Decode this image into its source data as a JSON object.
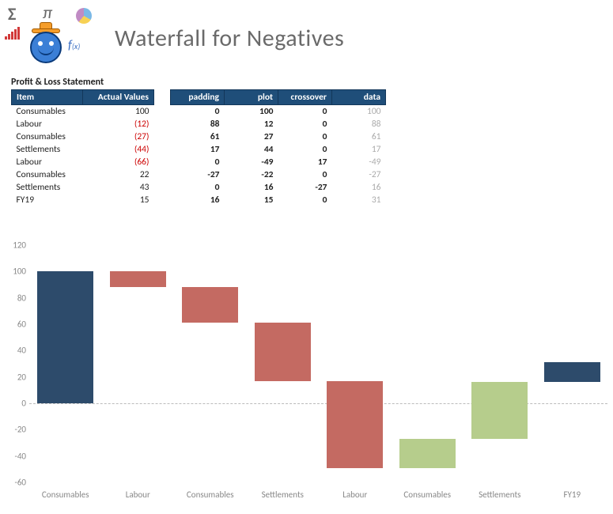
{
  "title": "Waterfall for Negatives",
  "subheader": "Profit & Loss Statement",
  "table_main": {
    "headers": [
      "Item",
      "Actual Values"
    ],
    "rows": [
      {
        "item": "Consumables",
        "val": "100",
        "neg": false
      },
      {
        "item": "Labour",
        "val": "(12)",
        "neg": true
      },
      {
        "item": "Consumables",
        "val": "(27)",
        "neg": true
      },
      {
        "item": "Settlements",
        "val": "(44)",
        "neg": true
      },
      {
        "item": "Labour",
        "val": "(66)",
        "neg": true
      },
      {
        "item": "Consumables",
        "val": "22",
        "neg": false
      },
      {
        "item": "Settlements",
        "val": "43",
        "neg": false
      },
      {
        "item": "FY19",
        "val": "15",
        "neg": false
      }
    ]
  },
  "table_calc": {
    "headers": [
      "padding",
      "plot",
      "crossover",
      "data"
    ],
    "rows": [
      {
        "padding": "0",
        "plot": "100",
        "crossover": "0",
        "data": "100"
      },
      {
        "padding": "88",
        "plot": "12",
        "crossover": "0",
        "data": "88"
      },
      {
        "padding": "61",
        "plot": "27",
        "crossover": "0",
        "data": "61"
      },
      {
        "padding": "17",
        "plot": "44",
        "crossover": "0",
        "data": "17"
      },
      {
        "padding": "0",
        "plot": "-49",
        "crossover": "17",
        "data": "-49"
      },
      {
        "padding": "-27",
        "plot": "-22",
        "crossover": "0",
        "data": "-27"
      },
      {
        "padding": "0",
        "plot": "16",
        "crossover": "-27",
        "data": "16"
      },
      {
        "padding": "16",
        "plot": "15",
        "crossover": "0",
        "data": "31"
      }
    ]
  },
  "chart_data": {
    "type": "bar",
    "title": "",
    "xlabel": "",
    "ylabel": "",
    "ylim": [
      -60,
      120
    ],
    "yticks": [
      -60,
      -40,
      -20,
      0,
      20,
      40,
      60,
      80,
      100,
      120
    ],
    "categories": [
      "Consumables",
      "Labour",
      "Consumables",
      "Settlements",
      "Labour",
      "Consumables",
      "Settlements",
      "FY19"
    ],
    "bars": [
      {
        "from": 0,
        "to": 100,
        "color": "dark"
      },
      {
        "from": 88,
        "to": 100,
        "color": "red"
      },
      {
        "from": 61,
        "to": 88,
        "color": "red"
      },
      {
        "from": 17,
        "to": 61,
        "color": "red"
      },
      {
        "from": -49,
        "to": 17,
        "color": "red"
      },
      {
        "from": -49,
        "to": -27,
        "color": "green"
      },
      {
        "from": -27,
        "to": 16,
        "color": "green"
      },
      {
        "from": 16,
        "to": 31,
        "color": "dark"
      }
    ]
  }
}
